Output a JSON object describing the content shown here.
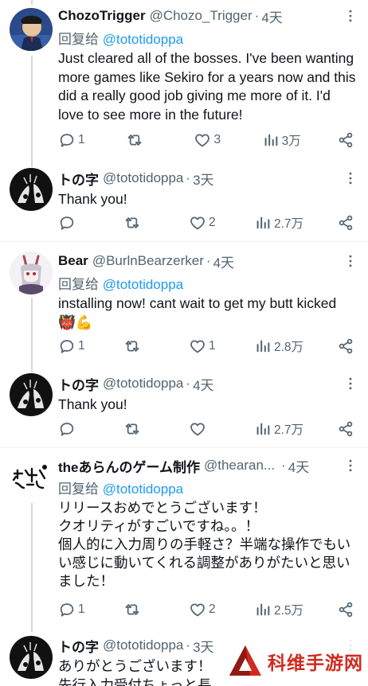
{
  "tweets": [
    {
      "name": "ChozoTrigger",
      "handle": "@Chozo_Trigger",
      "dot": "·",
      "time": "4天",
      "reply_prefix": "回复给 ",
      "reply_to": "@tototidoppa",
      "text": "Just cleared all of the bosses. I've been wanting more games like Sekiro for a years now and this did a really good job giving me more of it. I'd love to see more in the future!",
      "replies": "1",
      "retweets": "",
      "likes": "3",
      "views": "3万"
    },
    {
      "name": "トの字",
      "handle": "@tototidoppa",
      "dot": "·",
      "time": "3天",
      "text": "Thank you!",
      "replies": "",
      "retweets": "",
      "likes": "2",
      "views": "2.7万"
    },
    {
      "name": "Bear",
      "handle": "@BurlnBearzerker",
      "dot": "·",
      "time": "4天",
      "reply_prefix": "回复给 ",
      "reply_to": "@tototidoppa",
      "text": "installing now! cant wait to get my butt kicked",
      "emoji": "👹💪",
      "replies": "1",
      "retweets": "",
      "likes": "1",
      "views": "2.8万"
    },
    {
      "name": "トの字",
      "handle": "@tototidoppa",
      "dot": "·",
      "time": "4天",
      "text": "Thank you!",
      "replies": "",
      "retweets": "",
      "likes": "",
      "views": "2.7万"
    },
    {
      "name": "theあらんのゲーム制作",
      "handle": "@thearan...",
      "dot": "·",
      "time": "4天",
      "reply_prefix": "回复给 ",
      "reply_to": "@tototidoppa",
      "text": "リリースおめでとうございます！\nクオリティがすごいですね。。！\n個人的に入力周りの手軽さ？半端な操作でもいい感じに動いてくれる調整がありがたいと思いました！",
      "replies": "1",
      "retweets": "",
      "likes": "2",
      "views": "2.5万"
    },
    {
      "name": "トの字",
      "handle": "@tototidoppa",
      "dot": "·",
      "time": "3天",
      "text": "ありがとうございます！\n先行入力受付ちょっと長"
    }
  ],
  "watermark": {
    "text": "科维手游网"
  },
  "colors": {
    "accent": "#1d9bf0",
    "muted": "#536471",
    "text": "#0f1419",
    "line": "#cfd9de",
    "watermark": "#d12a1f"
  },
  "icons": [
    "more-icon",
    "reply-icon",
    "retweet-icon",
    "like-icon",
    "views-icon",
    "share-icon"
  ]
}
